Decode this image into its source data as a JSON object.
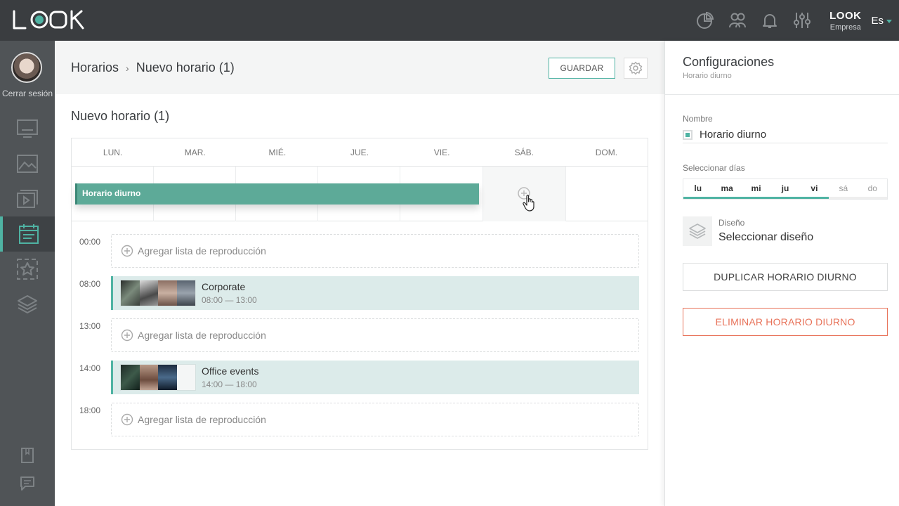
{
  "app": {
    "brand_name": "LOOK",
    "brand_role": "Empresa",
    "language": "Es"
  },
  "sidebar": {
    "logout_label": "Cerrar sesión"
  },
  "breadcrumb": {
    "root": "Horarios",
    "current": "Nuevo horario (1)"
  },
  "toolbar": {
    "save_label": "GUARDAR"
  },
  "schedule": {
    "title": "Nuevo horario (1)",
    "days": [
      "LUN.",
      "MAR.",
      "MIÉ.",
      "JUE.",
      "VIE.",
      "SÁB.",
      "DOM."
    ],
    "day_bar_label": "Horario diurno",
    "slots": [
      {
        "time": "00:00",
        "add_label": "Agregar lista de reproducción"
      },
      {
        "time": "08:00",
        "playlist": "Corporate",
        "range": "08:00 — 13:00"
      },
      {
        "time": "13:00",
        "add_label": "Agregar lista de reproducción"
      },
      {
        "time": "14:00",
        "playlist": "Office events",
        "range": "14:00 — 18:00"
      },
      {
        "time": "18:00",
        "add_label": "Agregar lista de reproducción"
      }
    ]
  },
  "panel": {
    "title": "Configuraciones",
    "subtitle": "Horario diurno",
    "name_label": "Nombre",
    "name_value": "Horario diurno",
    "days_label": "Seleccionar días",
    "day_options": [
      "lu",
      "ma",
      "mi",
      "ju",
      "vi",
      "sá",
      "do"
    ],
    "selected_days": [
      "lu",
      "ma",
      "mi",
      "ju",
      "vi"
    ],
    "design_label": "Diseño",
    "design_value": "Seleccionar diseño",
    "duplicate_label": "DUPLICAR HORARIO DIURNO",
    "delete_label": "ELIMINAR HORARIO DIURNO"
  },
  "colors": {
    "accent": "#4fb3a3",
    "danger": "#e8735a",
    "topbar": "#3a3d40",
    "sidebar": "#505457"
  }
}
